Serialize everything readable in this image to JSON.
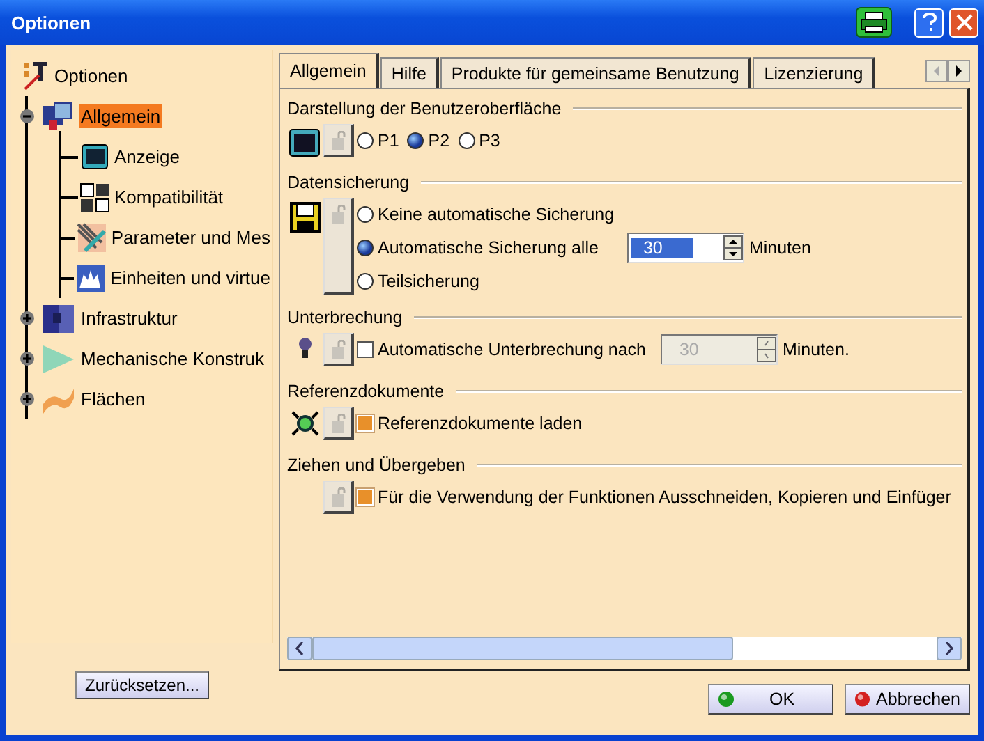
{
  "window": {
    "title": "Optionen"
  },
  "tree": {
    "root": "Optionen",
    "items": [
      {
        "label": "Allgemein",
        "selected": true,
        "expanded": true,
        "children": [
          {
            "label": "Anzeige"
          },
          {
            "label": "Kompatibilität"
          },
          {
            "label": "Parameter und Mes"
          },
          {
            "label": "Einheiten und virtue"
          }
        ]
      },
      {
        "label": "Infrastruktur",
        "selected": false,
        "expanded": false
      },
      {
        "label": "Mechanische Konstruk",
        "selected": false,
        "expanded": false
      },
      {
        "label": "Flächen",
        "selected": false,
        "expanded": false
      }
    ]
  },
  "tabs": [
    {
      "label": "Allgemein",
      "selected": true
    },
    {
      "label": "Hilfe",
      "selected": false
    },
    {
      "label": "Produkte für gemeinsame Benutzung",
      "selected": false
    },
    {
      "label": "Lizenzierung",
      "selected": false
    }
  ],
  "sections": [
    {
      "title": "Darstellung der Benutzeroberfläche",
      "kind": "inline",
      "options": [
        {
          "kind": "radio",
          "label": "P1",
          "selected": false
        },
        {
          "kind": "radio",
          "label": "P2",
          "selected": true
        },
        {
          "kind": "radio",
          "label": "P3",
          "selected": false
        }
      ]
    },
    {
      "title": "Datensicherung",
      "kind": "stack",
      "options": [
        {
          "kind": "radio",
          "label": "Keine automatische Sicherung",
          "selected": false
        },
        {
          "kind": "radio",
          "label": "Automatische Sicherung alle",
          "selected": true,
          "spinner": {
            "value": "30",
            "disabled": false,
            "unit": "Minuten"
          }
        },
        {
          "kind": "radio",
          "label": "Teilsicherung",
          "selected": false
        }
      ]
    },
    {
      "title": "Unterbrechung",
      "kind": "stack",
      "options": [
        {
          "kind": "checkbox",
          "label": "Automatische Unterbrechung nach",
          "checked": false,
          "spinner": {
            "value": "30",
            "disabled": true,
            "unit": "Minuten."
          }
        }
      ]
    },
    {
      "title": "Referenzdokumente",
      "kind": "stack",
      "options": [
        {
          "kind": "checkbox",
          "label": "Referenzdokumente laden",
          "checked": true
        }
      ]
    },
    {
      "title": "Ziehen und Übergeben",
      "kind": "stack",
      "options": [
        {
          "kind": "checkbox",
          "label": "Für die Verwendung der Funktionen Ausschneiden, Kopieren und Einfüger",
          "checked": true
        }
      ]
    }
  ],
  "reset_button": "Zurücksetzen...",
  "buttons": [
    {
      "label": "OK",
      "kind": "ok"
    },
    {
      "label": "Abbrechen",
      "kind": "cancel"
    }
  ]
}
